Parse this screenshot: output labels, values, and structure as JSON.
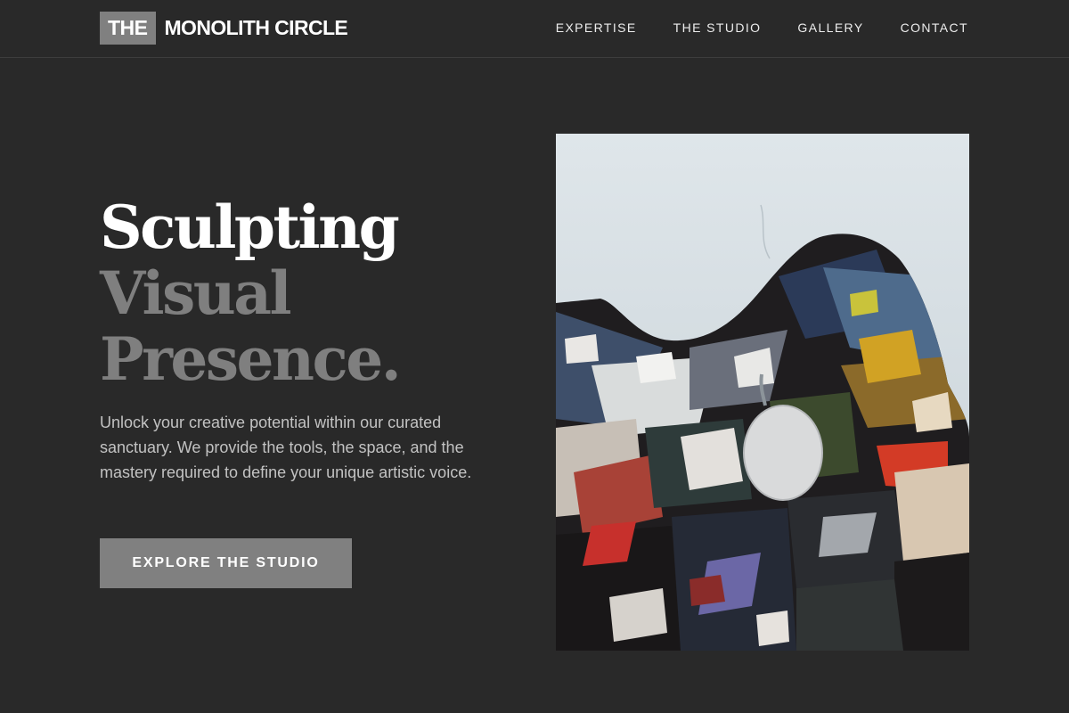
{
  "brand": {
    "prefix": "THE",
    "name": "MONOLITH CIRCLE"
  },
  "nav": {
    "items": [
      {
        "label": "EXPERTISE"
      },
      {
        "label": "THE STUDIO"
      },
      {
        "label": "GALLERY"
      },
      {
        "label": "CONTACT"
      }
    ]
  },
  "hero": {
    "headline": {
      "line1": "Sculpting",
      "line2": "Visual",
      "line3": "Presence."
    },
    "intro": "Unlock your creative potential within our curated sanctuary. We provide the tools, the space, and the mastery required to define your unique artistic voice.",
    "cta_label": "EXPLORE THE STUDIO"
  },
  "colors": {
    "background": "#292929",
    "accent_gray": "#808080",
    "headline_white": "#ffffff",
    "headline_gray": "#7f7f7f",
    "body_text": "#c2c2c2"
  }
}
